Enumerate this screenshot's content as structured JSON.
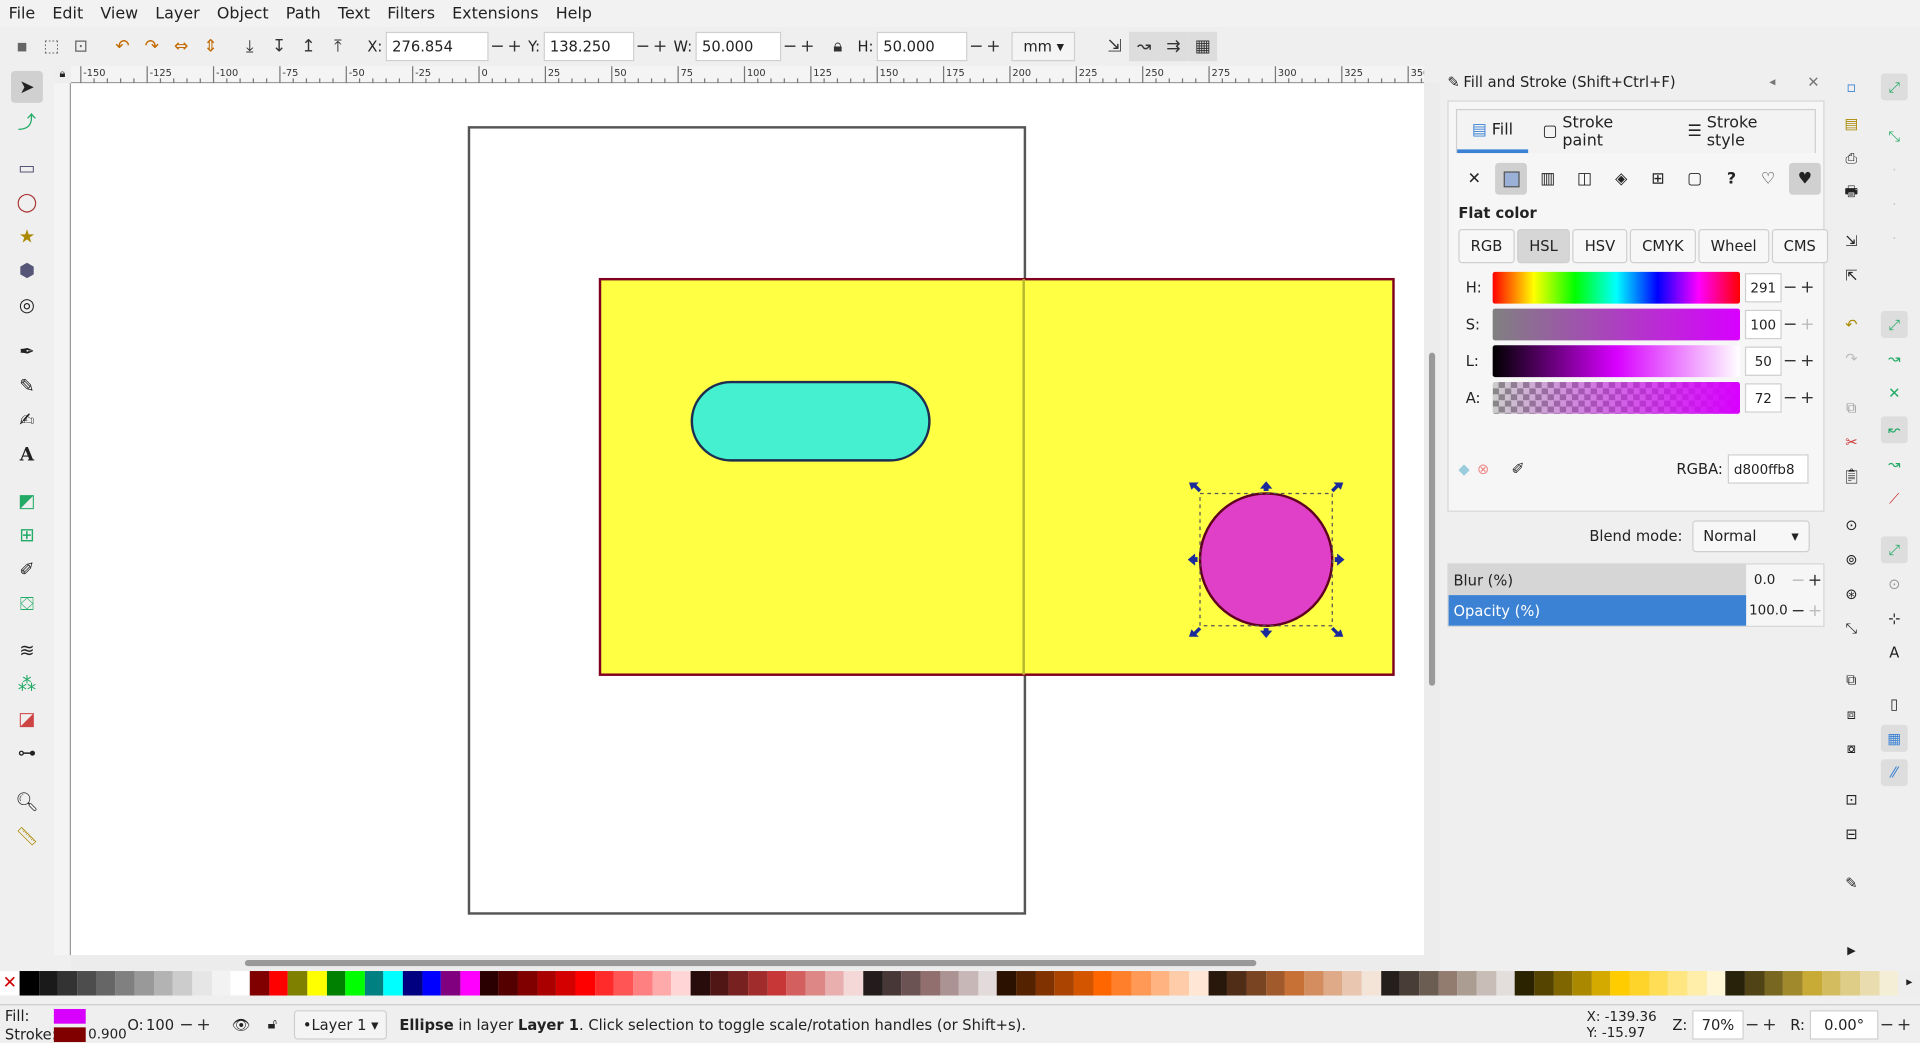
{
  "menu": [
    "File",
    "Edit",
    "View",
    "Layer",
    "Object",
    "Path",
    "Text",
    "Filters",
    "Extensions",
    "Help"
  ],
  "toolbar": {
    "x_label": "X:",
    "x_value": "276.854",
    "y_label": "Y:",
    "y_value": "138.250",
    "w_label": "W:",
    "w_value": "50.000",
    "h_label": "H:",
    "h_value": "50.000",
    "unit": "mm"
  },
  "ruler_labels": [
    "-150",
    "-125",
    "-100",
    "-75",
    "-50",
    "-25",
    "0",
    "25",
    "50",
    "75",
    "100",
    "125",
    "150",
    "175",
    "200",
    "225",
    "250",
    "275",
    "300",
    "325",
    "350"
  ],
  "dialog": {
    "title": "Fill and Stroke (Shift+Ctrl+F)",
    "tabs": [
      "Fill",
      "Stroke paint",
      "Stroke style"
    ],
    "flat_color": "Flat color",
    "color_modes": [
      "RGB",
      "HSL",
      "HSV",
      "CMYK",
      "Wheel",
      "CMS"
    ],
    "sliders": [
      {
        "label": "H:",
        "value": "291"
      },
      {
        "label": "S:",
        "value": "100"
      },
      {
        "label": "L:",
        "value": "50"
      },
      {
        "label": "A:",
        "value": "72"
      }
    ],
    "rgba_label": "RGBA:",
    "rgba_value": "d800ffb8",
    "blend_label": "Blend mode:",
    "blend_value": "Normal",
    "blur_label": "Blur (%)",
    "blur_value": "0.0",
    "opacity_label": "Opacity (%)",
    "opacity_value": "100.0"
  },
  "status": {
    "fill_label": "Fill:",
    "stroke_label": "Stroke:",
    "stroke_width": "0.900",
    "o_label": "O:",
    "o_value": "100",
    "layer": "•Layer 1",
    "message_bold": "Ellipse",
    "message_mid": " in layer ",
    "message_layer": "Layer 1",
    "message_end": ". Click selection to toggle scale/rotation handles (or Shift+s).",
    "cx": "X: -139.36",
    "cy": "Y: -15.97",
    "z_label": "Z:",
    "zoom": "70%",
    "r_label": "R:",
    "rotation": "0.00°"
  },
  "colors": {
    "fill": "#d800ff",
    "stroke": "#800000",
    "rect": "#ffff44",
    "pill": "#44f0d0",
    "circle": "#e040c8",
    "accent": "#3b82d4"
  }
}
